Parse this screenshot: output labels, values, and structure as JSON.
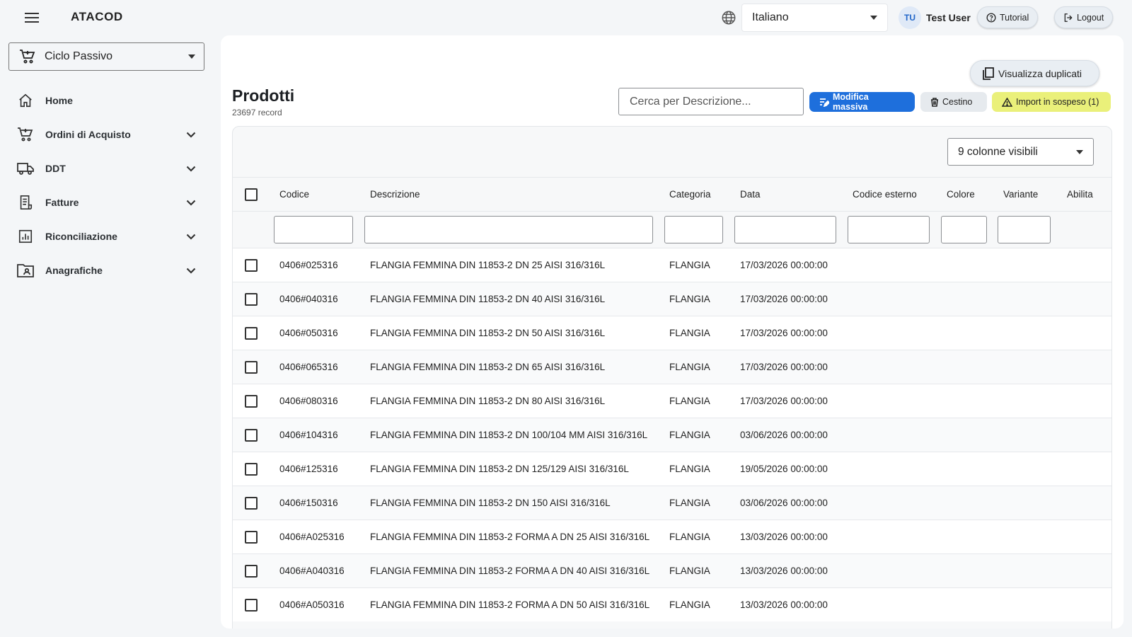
{
  "header": {
    "app_title": "ATACOD",
    "language": "Italiano",
    "user_initials": "TU",
    "user_name": "Test User",
    "tutorial_label": "Tutorial",
    "logout_label": "Logout"
  },
  "sidebar": {
    "module": "Ciclo Passivo",
    "items": [
      {
        "label": "Home",
        "icon": "home-icon",
        "expandable": false
      },
      {
        "label": "Ordini di Acquisto",
        "icon": "cart-icon",
        "expandable": true
      },
      {
        "label": "DDT",
        "icon": "truck-icon",
        "expandable": true
      },
      {
        "label": "Fatture",
        "icon": "invoice-icon",
        "expandable": true
      },
      {
        "label": "Riconciliazione",
        "icon": "chart-report-icon",
        "expandable": true
      },
      {
        "label": "Anagrafiche",
        "icon": "contact-folder-icon",
        "expandable": true
      }
    ]
  },
  "main": {
    "duplicates_label": "Visualizza duplicati",
    "title": "Prodotti",
    "record_count": "23697 record",
    "search_placeholder": "Cerca per Descrizione...",
    "bulk_edit_label": "Modifica massiva",
    "trash_label": "Cestino",
    "pending_import_label": "Import in sospeso (1)",
    "columns_visible_label": "9 colonne visibili",
    "colors": {
      "primary": "#1e6fdc",
      "warning": "#eaf07a"
    }
  },
  "table": {
    "columns": [
      "Codice",
      "Descrizione",
      "Categoria",
      "Data",
      "Codice esterno",
      "Colore",
      "Variante",
      "Abilita"
    ],
    "rows": [
      {
        "codice": "0406#025316",
        "descrizione": "FLANGIA FEMMINA DIN 11853-2 DN 25 AISI 316/316L",
        "categoria": "FLANGIA",
        "data": "17/03/2026 00:00:00"
      },
      {
        "codice": "0406#040316",
        "descrizione": "FLANGIA FEMMINA DIN 11853-2 DN 40 AISI 316/316L",
        "categoria": "FLANGIA",
        "data": "17/03/2026 00:00:00"
      },
      {
        "codice": "0406#050316",
        "descrizione": "FLANGIA FEMMINA DIN 11853-2 DN 50 AISI 316/316L",
        "categoria": "FLANGIA",
        "data": "17/03/2026 00:00:00"
      },
      {
        "codice": "0406#065316",
        "descrizione": "FLANGIA FEMMINA DIN 11853-2 DN 65 AISI 316/316L",
        "categoria": "FLANGIA",
        "data": "17/03/2026 00:00:00"
      },
      {
        "codice": "0406#080316",
        "descrizione": "FLANGIA FEMMINA DIN 11853-2 DN 80 AISI 316/316L",
        "categoria": "FLANGIA",
        "data": "17/03/2026 00:00:00"
      },
      {
        "codice": "0406#104316",
        "descrizione": "FLANGIA FEMMINA DIN 11853-2 DN 100/104 MM AISI 316/316L",
        "categoria": "FLANGIA",
        "data": "03/06/2026 00:00:00"
      },
      {
        "codice": "0406#125316",
        "descrizione": "FLANGIA FEMMINA DIN 11853-2 DN 125/129 AISI 316/316L",
        "categoria": "FLANGIA",
        "data": "19/05/2026 00:00:00"
      },
      {
        "codice": "0406#150316",
        "descrizione": "FLANGIA FEMMINA DIN 11853-2 DN 150 AISI 316/316L",
        "categoria": "FLANGIA",
        "data": "03/06/2026 00:00:00"
      },
      {
        "codice": "0406#A025316",
        "descrizione": "FLANGIA FEMMINA DIN 11853-2 FORMA A DN 25 AISI 316/316L",
        "categoria": "FLANGIA",
        "data": "13/03/2026 00:00:00"
      },
      {
        "codice": "0406#A040316",
        "descrizione": "FLANGIA FEMMINA DIN 11853-2 FORMA A DN 40 AISI 316/316L",
        "categoria": "FLANGIA",
        "data": "13/03/2026 00:00:00"
      },
      {
        "codice": "0406#A050316",
        "descrizione": "FLANGIA FEMMINA DIN 11853-2 FORMA A DN 50 AISI 316/316L",
        "categoria": "FLANGIA",
        "data": "13/03/2026 00:00:00"
      }
    ]
  }
}
